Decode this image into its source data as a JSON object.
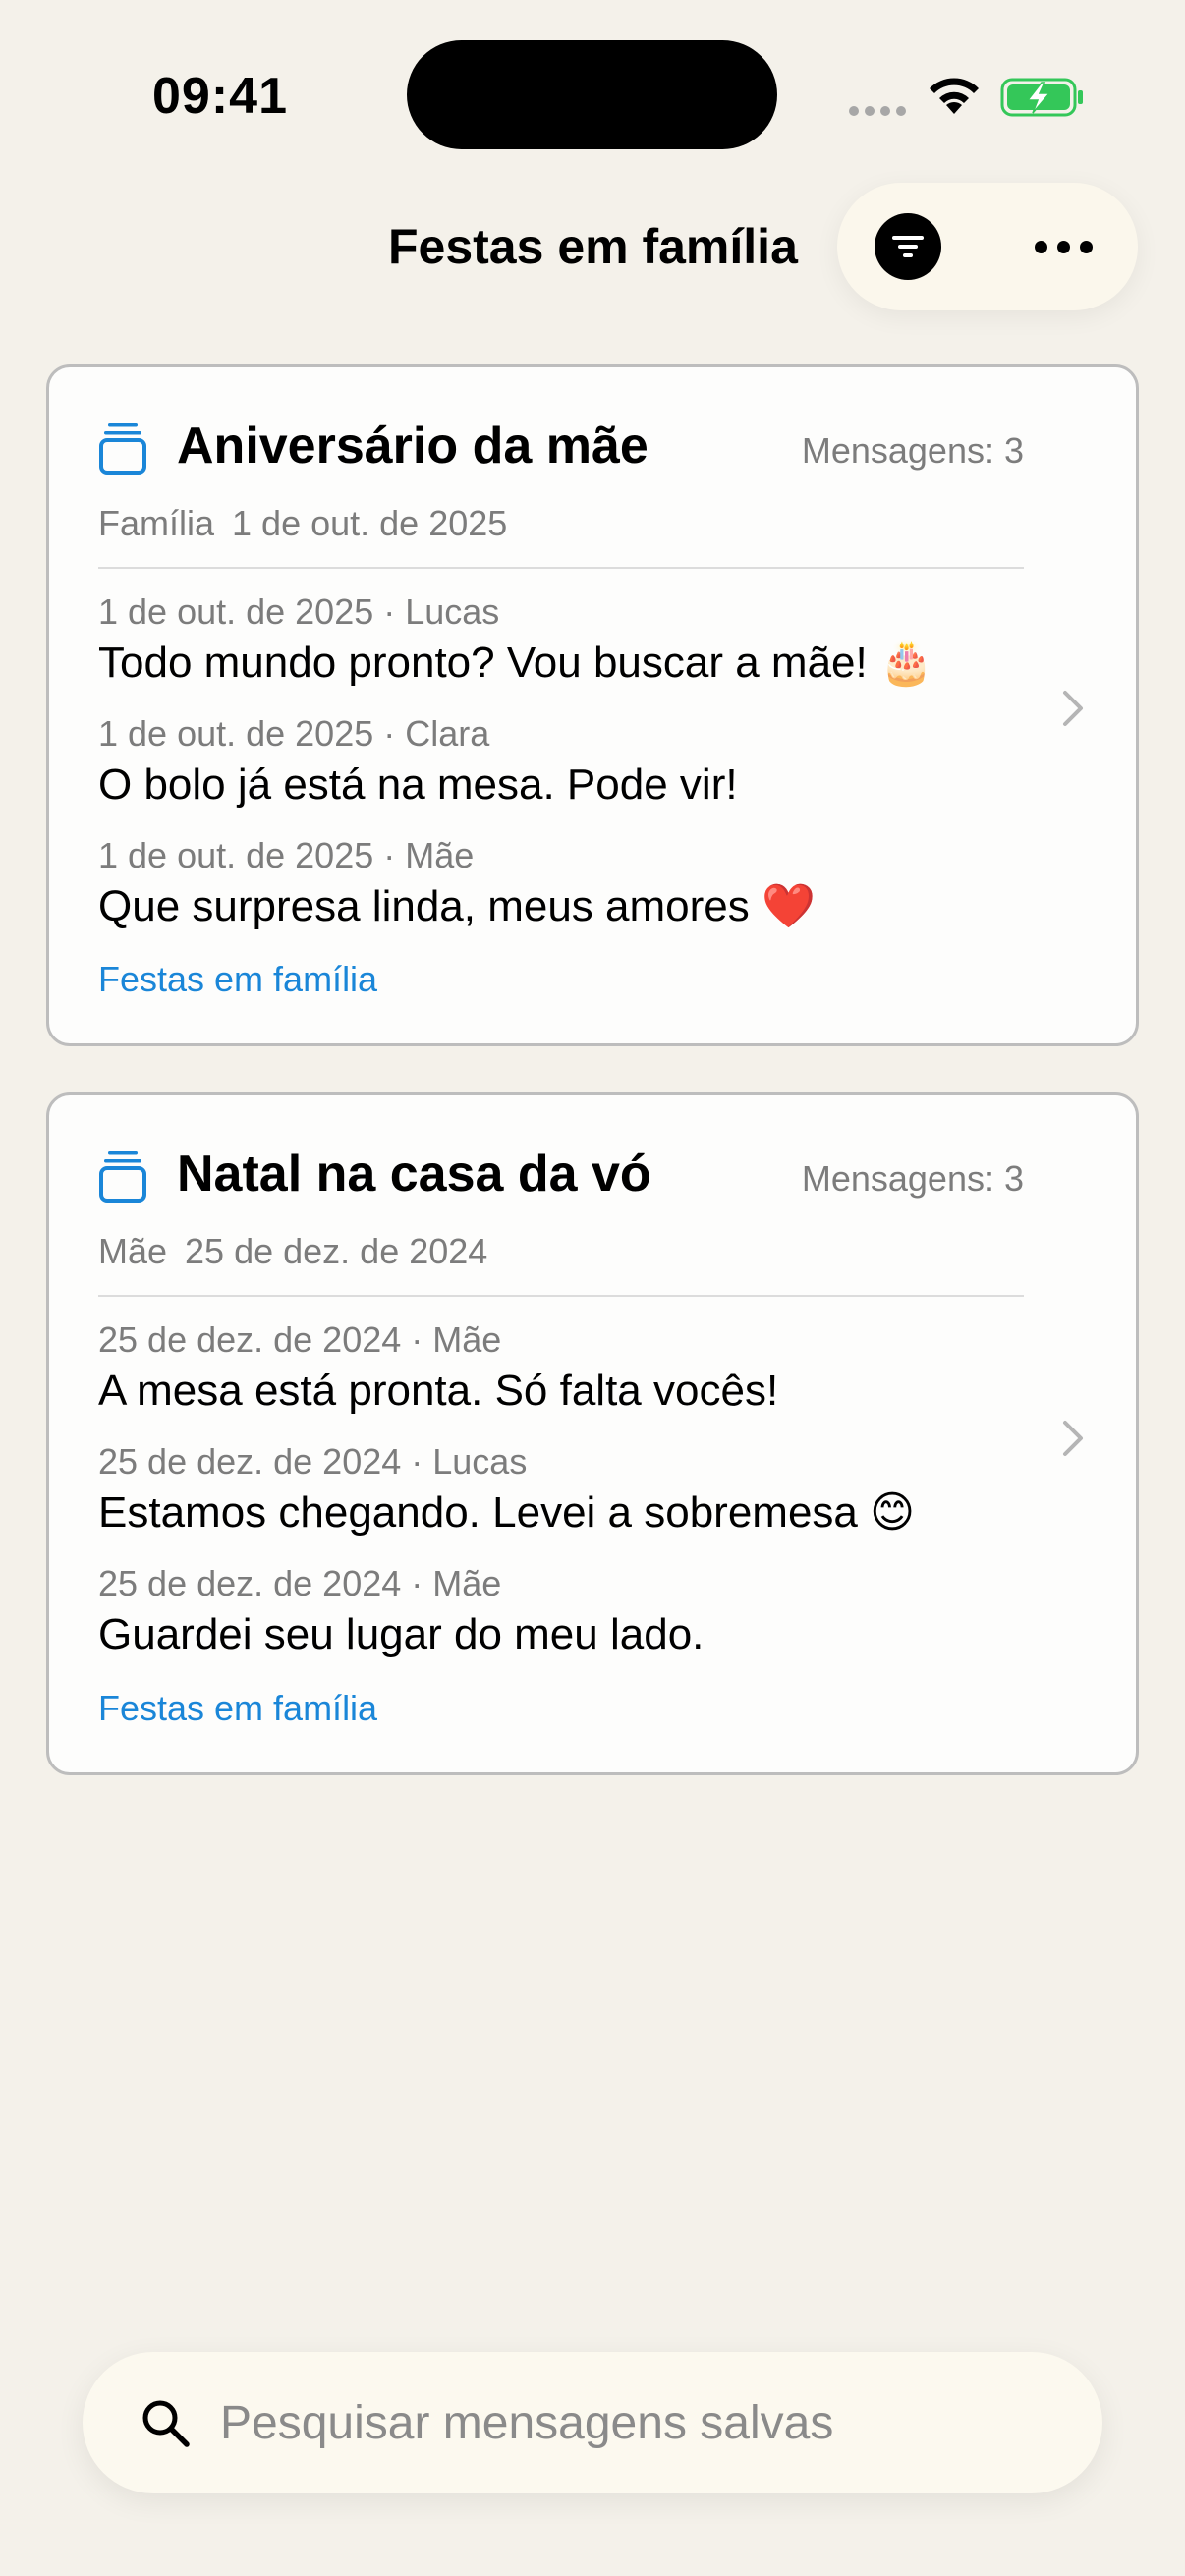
{
  "status_bar": {
    "time": "09:41"
  },
  "header": {
    "title": "Festas em família",
    "filter_icon": "filter-lines-icon",
    "more_icon": "ellipsis-icon"
  },
  "colors": {
    "background": "#f4f1ea",
    "card_background": "#fdfdfc",
    "accent": "#1a86d8",
    "secondary_text": "#7c7c7c",
    "battery": "#34c759"
  },
  "collections": [
    {
      "title": "Aniversário da mãe",
      "count_label": "Mensagens: 3",
      "meta_label": "Família",
      "meta_date": "1 de out. de 2025",
      "messages": [
        {
          "meta": "1 de out. de 2025 · Lucas",
          "text": "Todo mundo pronto? Vou buscar a mãe! 🎂"
        },
        {
          "meta": "1 de out. de 2025 · Clara",
          "text": "O bolo já está na mesa. Pode vir!"
        },
        {
          "meta": "1 de out. de 2025 · Mãe",
          "text": "Que surpresa linda, meus amores ❤️"
        }
      ],
      "link": "Festas em família"
    },
    {
      "title": "Natal na casa da vó",
      "count_label": "Mensagens: 3",
      "meta_label": "Mãe",
      "meta_date": "25 de dez. de 2024",
      "messages": [
        {
          "meta": "25 de dez. de 2024 · Mãe",
          "text": "A mesa está pronta. Só falta vocês!"
        },
        {
          "meta": "25 de dez. de 2024 · Lucas",
          "text": "Estamos chegando. Levei a sobremesa 😊"
        },
        {
          "meta": "25 de dez. de 2024 · Mãe",
          "text": "Guardei seu lugar do meu lado."
        }
      ],
      "link": "Festas em família"
    }
  ],
  "search": {
    "placeholder": "Pesquisar mensagens salvas",
    "value": ""
  }
}
